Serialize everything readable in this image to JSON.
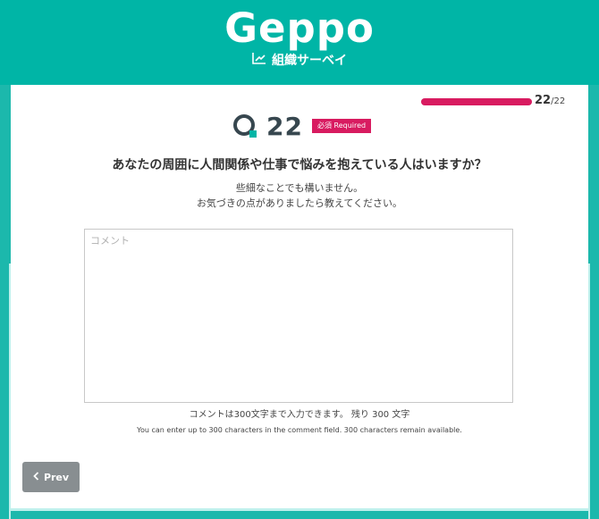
{
  "header": {
    "logo_text": "Geppo",
    "subtitle": "組織サーベイ"
  },
  "progress": {
    "current": "22",
    "total": "/22",
    "fraction": 1.0
  },
  "question": {
    "number": "22",
    "required_badge": "必須 Required",
    "text": "あなたの周囲に人間関係や仕事で悩みを抱えている人はいますか？",
    "hint_line1": "些細なことでも構いません。",
    "hint_line2": "お気づきの点がありましたら教えてください。"
  },
  "comment": {
    "placeholder": "コメント",
    "value": "",
    "limit_ja": "コメントは300文字まで入力できます。 残り 300 文字",
    "limit_en": "You can enter up to 300 characters in the comment field. 300 characters remain available."
  },
  "nav": {
    "prev_label": "Prev"
  },
  "colors": {
    "brand": "#00b5a6",
    "accent": "#d81b60",
    "text": "#333333",
    "button": "#888e91"
  }
}
